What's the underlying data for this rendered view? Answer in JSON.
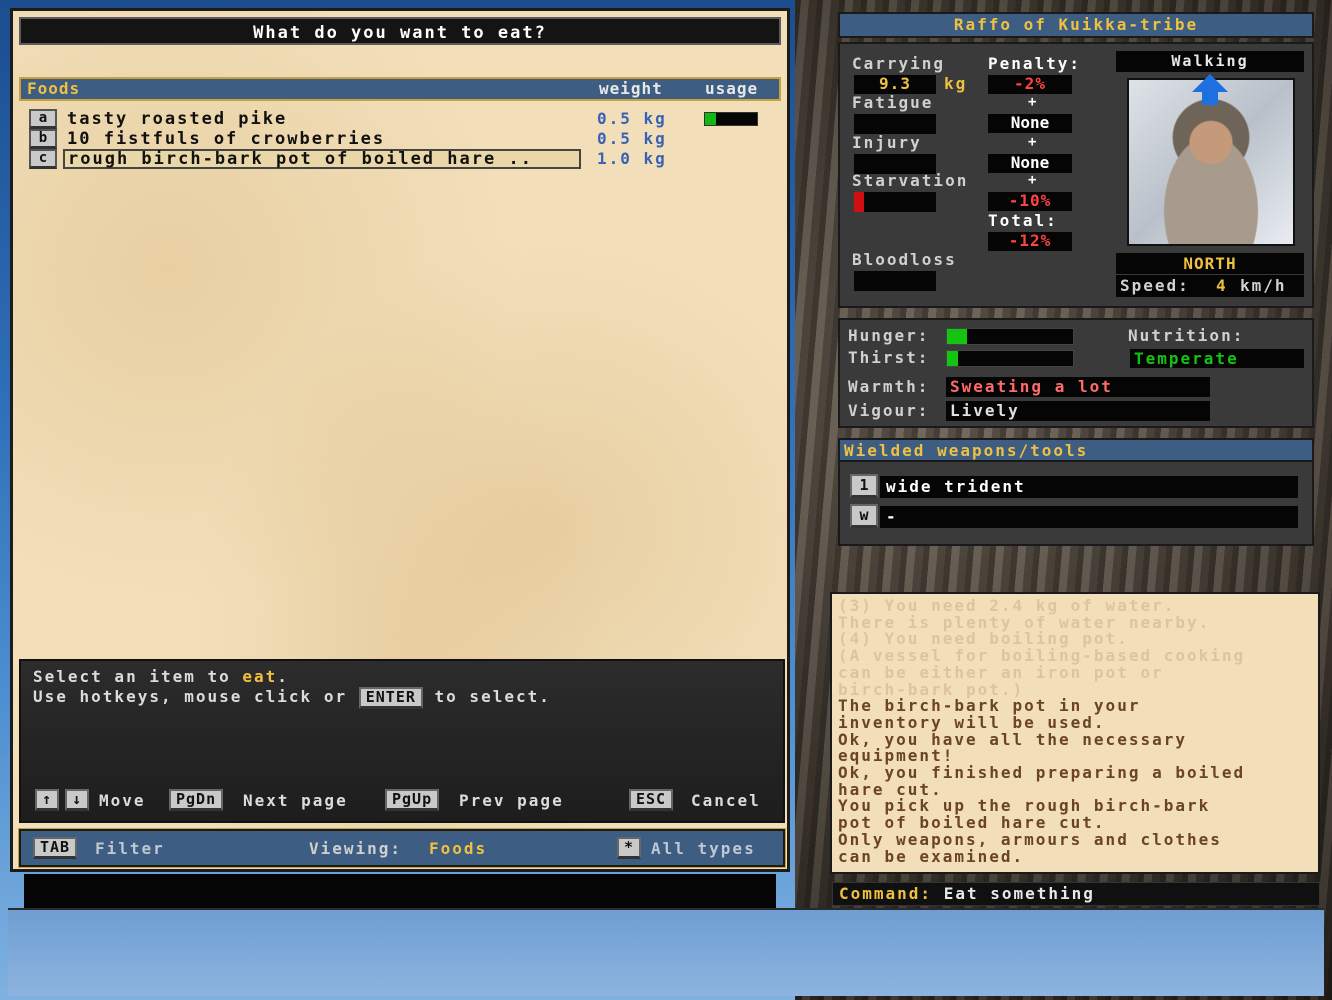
{
  "window": {
    "title": "What do you want to eat?"
  },
  "list": {
    "headers": {
      "category": "Foods",
      "weight": "weight",
      "usage": "usage"
    },
    "items": [
      {
        "key": "a",
        "name": "tasty roasted pike",
        "weight": "0.5 kg",
        "usage_fraction": 0.22
      },
      {
        "key": "b",
        "name": "10 fistfuls of crowberries",
        "weight": "0.5 kg"
      },
      {
        "key": "c",
        "name": "rough birch-bark pot of boiled hare ..",
        "weight": "1.0 kg",
        "selected": true
      }
    ]
  },
  "instructions": {
    "line1_prefix": "Select an item to ",
    "line1_highlight": "eat",
    "line1_suffix": ".",
    "line2_prefix": "Use hotkeys, mouse click or",
    "line2_key": "ENTER",
    "line2_suffix": "to select.",
    "up_key": "↑",
    "down_key": "↓",
    "move_label": "Move",
    "pgdn_key": "PgDn",
    "pgdn_label": "Next page",
    "pgup_key": "PgUp",
    "pgup_label": "Prev page",
    "esc_key": "ESC",
    "esc_label": "Cancel"
  },
  "filter_bar": {
    "tab_key": "TAB",
    "filter_label": "Filter",
    "viewing_label": "Viewing:",
    "viewing_value": "Foods",
    "star_key": "*",
    "all_types_label": "All types"
  },
  "character": {
    "name": "Raffo of Kuikka-tribe",
    "carrying_label": "Carrying",
    "carrying_value": "9.3",
    "carrying_unit": "kg",
    "penalty_label": "Penalty:",
    "penalty_value": "-2%",
    "fatigue_label": "Fatigue",
    "fatigue_penalty": "None",
    "injury_label": "Injury",
    "injury_penalty": "None",
    "starvation_label": "Starvation",
    "starvation_penalty": "-10%",
    "starvation_fraction": 0.12,
    "total_label": "Total:",
    "total_value": "-12%",
    "bloodloss_label": "Bloodloss",
    "plus_sign": "+",
    "movement_mode": "Walking",
    "direction": "NORTH",
    "speed_label": "Speed:",
    "speed_value": "4",
    "speed_unit": "km/h",
    "portrait_icon": "character-portrait",
    "direction_icon": "arrow-up-icon"
  },
  "status": {
    "hunger_label": "Hunger:",
    "hunger_fraction": 0.16,
    "thirst_label": "Thirst:",
    "thirst_fraction": 0.09,
    "nutrition_label": "Nutrition:",
    "nutrition_value": "Temperate",
    "warmth_label": "Warmth:",
    "warmth_value": "Sweating a lot",
    "vigour_label": "Vigour:",
    "vigour_value": "Lively"
  },
  "weapons": {
    "title": "Wielded weapons/tools",
    "slots": [
      {
        "key": "1",
        "value": "wide trident"
      },
      {
        "key": "w",
        "value": "-"
      }
    ]
  },
  "log": {
    "lines": [
      {
        "text": "(3) You need 2.4 kg of water.",
        "faded": true
      },
      {
        "text": "There is plenty of water nearby.",
        "faded": true
      },
      {
        "text": "(4) You need boiling pot.",
        "faded": true
      },
      {
        "text": "(A vessel for boiling-based cooking",
        "faded": true
      },
      {
        "text": "can be either an iron pot or",
        "faded": true
      },
      {
        "text": "birch-bark pot.)",
        "faded": true
      },
      {
        "text": "The birch-bark pot in your",
        "faded": false
      },
      {
        "text": "inventory will be used.",
        "faded": false
      },
      {
        "text": "Ok, you have all the necessary",
        "faded": false
      },
      {
        "text": "equipment!",
        "faded": false
      },
      {
        "text": "Ok, you finished preparing a boiled",
        "faded": false
      },
      {
        "text": "hare cut.",
        "faded": false
      },
      {
        "text": "You pick up the rough birch-bark",
        "faded": false
      },
      {
        "text": "pot of boiled hare cut.",
        "faded": false
      },
      {
        "text": "Only weapons, armours and clothes",
        "faded": false
      },
      {
        "text": "can be examined.",
        "faded": false
      }
    ]
  },
  "command": {
    "label": "Command:",
    "value": "Eat something"
  },
  "colors": {
    "accent_yellow": "#f0c040",
    "header_blue": "#3d5e82",
    "penalty_red": "#ff4444",
    "bar_green": "#13c413",
    "parchment": "#f2dfba"
  }
}
